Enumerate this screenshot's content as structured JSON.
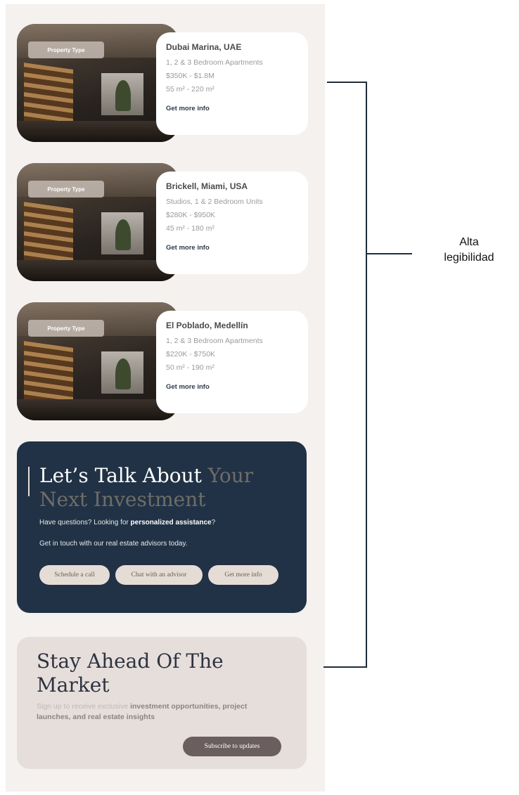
{
  "properties": [
    {
      "badge": "Property Type",
      "city": "Dubai Marina, UAE",
      "units": "1, 2 & 3 Bedroom Apartments",
      "price": "$350K - $1.8M",
      "area": "55 m² - 220 m²",
      "link": "Get more info"
    },
    {
      "badge": "Property Type",
      "city": "Brickell, Miami, USA",
      "units": "Studios, 1 & 2 Bedroom Units",
      "price": "$280K - $950K",
      "area": "45 m² - 180 m²",
      "link": "Get more info"
    },
    {
      "badge": "Property Type",
      "city": "El Poblado, Medellín",
      "units": "1, 2 & 3 Bedroom Apartments",
      "price": "$220K - $750K",
      "area": "50 m² - 190 m²",
      "link": "Get more info"
    }
  ],
  "contact": {
    "title_a": "Let’s Talk About",
    "title_b": "Your Next Investment",
    "question_a": "Have questions? Looking for",
    "question_b": "personalized assistance",
    "question_c": "?",
    "subtitle": "Get in touch with our real estate advisors today.",
    "buttons": [
      "Schedule a call",
      "Chat with an advisor",
      "Get more info"
    ]
  },
  "newsletter": {
    "title": "Stay Ahead Of The Market",
    "desc_a": "Sign up to receive exclusive",
    "desc_b": "investment opportunities, project launches, and real estate insights",
    "button": "Subscribe to updates"
  },
  "annotation": {
    "label_line1": "Alta",
    "label_line2": "legibilidad",
    "color": "#1f2d3a"
  },
  "colors": {
    "page_bg": "#f4f1ee",
    "contact_bg": "#213246",
    "newsletter_bg": "#e6dedb",
    "subscribe_btn": "#6a5e5e"
  }
}
